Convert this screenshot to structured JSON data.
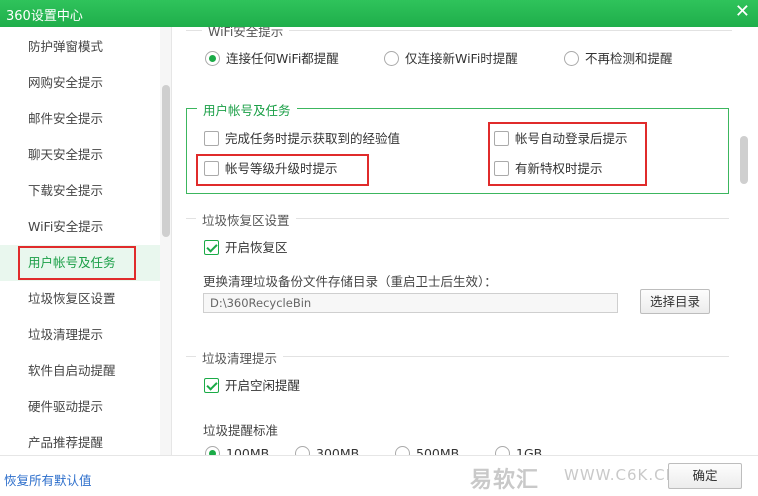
{
  "window": {
    "title": "360设置中心",
    "close_glyph": "✕"
  },
  "sidebar": {
    "items": [
      {
        "label": "防护弹窗模式"
      },
      {
        "label": "网购安全提示"
      },
      {
        "label": "邮件安全提示"
      },
      {
        "label": "聊天安全提示"
      },
      {
        "label": "下载安全提示"
      },
      {
        "label": "WiFi安全提示"
      },
      {
        "label": "用户帐号及任务",
        "active": true
      },
      {
        "label": "垃圾恢复区设置"
      },
      {
        "label": "垃圾清理提示"
      },
      {
        "label": "软件自启动提醒"
      },
      {
        "label": "硬件驱动提示"
      },
      {
        "label": "产品推荐提醒"
      }
    ]
  },
  "wifi_section": {
    "title": "WiFi安全提示",
    "options": [
      {
        "label": "连接任何WiFi都提醒",
        "selected": true
      },
      {
        "label": "仅连接新WiFi时提醒",
        "selected": false
      },
      {
        "label": "不再检测和提醒",
        "selected": false
      }
    ]
  },
  "account_section": {
    "title": "用户帐号及任务",
    "options": [
      {
        "label": "完成任务时提示获取到的经验值",
        "checked": false
      },
      {
        "label": "帐号等级升级时提示",
        "checked": false
      },
      {
        "label": "帐号自动登录后提示",
        "checked": false
      },
      {
        "label": "有新特权时提示",
        "checked": false
      }
    ]
  },
  "recycle_section": {
    "title": "垃圾恢复区设置",
    "enable_label": "开启恢复区",
    "enable_checked": true,
    "dir_caption": "更换清理垃圾备份文件存储目录（重启卫士后生效）：",
    "path_value": "D:\\360RecycleBin",
    "select_button": "选择目录"
  },
  "cleanup_section": {
    "title": "垃圾清理提示",
    "idle_label": "开启空闲提醒",
    "idle_checked": true,
    "threshold_caption": "垃圾提醒标准",
    "thresholds": [
      {
        "label": "100MB",
        "selected": true
      },
      {
        "label": "300MB",
        "selected": false
      },
      {
        "label": "500MB",
        "selected": false
      },
      {
        "label": "1GB",
        "selected": false
      }
    ]
  },
  "footer": {
    "restore_label": "恢复所有默认值",
    "ok_button": "确定",
    "watermark_text": "易软汇",
    "watermark_url": "WWW.C6K.CN"
  },
  "colors": {
    "accent": "#1bab47",
    "highlight_box": "#e02b2b",
    "link": "#2c6ecb"
  }
}
